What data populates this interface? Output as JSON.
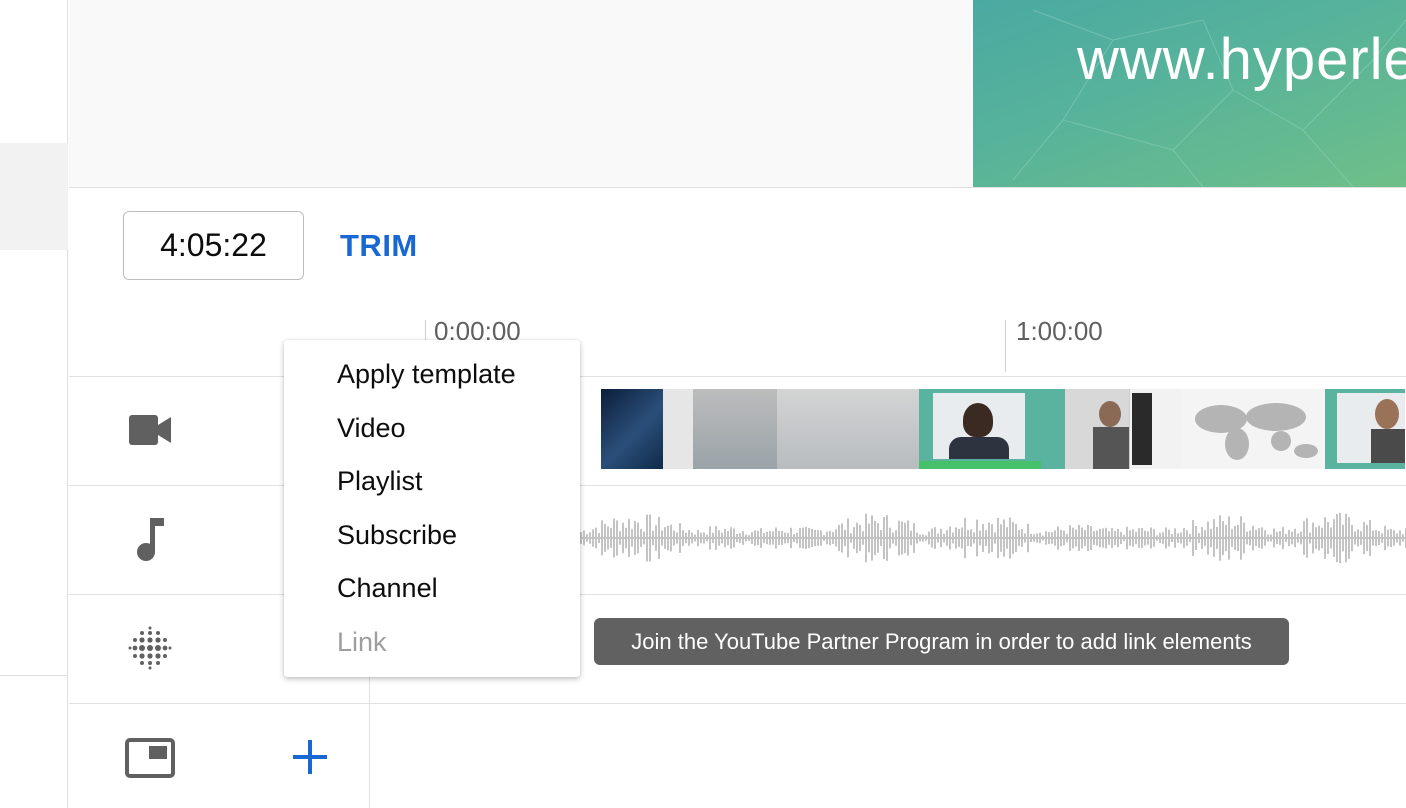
{
  "preview": {
    "url_text": "www.hyperle"
  },
  "editor": {
    "timestamp": "4:05:22",
    "trim_label": "TRIM"
  },
  "timeline": {
    "ruler_labels": [
      "0:00:00",
      "1:00:00"
    ]
  },
  "rows": [
    {
      "name": "video",
      "icon": "video-camera-icon"
    },
    {
      "name": "audio",
      "icon": "music-note-icon"
    },
    {
      "name": "elements",
      "icon": "dots-grid-icon"
    },
    {
      "name": "end-screen",
      "icon": "picture-in-picture-icon"
    }
  ],
  "menu": {
    "items": [
      {
        "label": "Apply template",
        "disabled": false
      },
      {
        "label": "Video",
        "disabled": false
      },
      {
        "label": "Playlist",
        "disabled": false
      },
      {
        "label": "Subscribe",
        "disabled": false
      },
      {
        "label": "Channel",
        "disabled": false
      },
      {
        "label": "Link",
        "disabled": true
      }
    ]
  },
  "tooltip": {
    "text": "Join the YouTube Partner Program in order to add link elements"
  },
  "colors": {
    "accent": "#1967d2",
    "icon": "#606060",
    "tooltip_bg": "#616161",
    "disabled_text": "#9e9e9e"
  }
}
